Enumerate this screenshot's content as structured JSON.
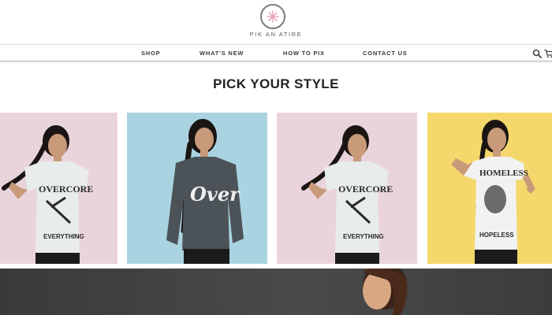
{
  "brand": {
    "name": "PIK AN ATIRE",
    "logo_color": "#e59ab5"
  },
  "nav": {
    "items": [
      {
        "label": "SHOP"
      },
      {
        "label": "WHAT'S NEW"
      },
      {
        "label": "HOW TO PIX"
      },
      {
        "label": "CONTACT US"
      }
    ],
    "icons": [
      "search-icon",
      "cart-icon"
    ]
  },
  "main": {
    "heading": "PICK YOUR STYLE"
  },
  "products": [
    {
      "shirt_text_top": "OVERCORE",
      "shirt_text_bottom": "EVERYTHING",
      "background": "#ead4dc",
      "shirt_color": "#e9ecec"
    },
    {
      "shirt_text_top": "Over",
      "background": "#aad3e1",
      "shirt_color": "#4c5358"
    },
    {
      "shirt_text_top": "OVERCORE",
      "shirt_text_bottom": "EVERYTHING",
      "background": "#ead4dc",
      "shirt_color": "#e9ecec"
    },
    {
      "shirt_text_top": "HOMELESS",
      "shirt_text_bottom": "HOPELESS",
      "background": "#f4d86c",
      "shirt_color": "#f2f2f2"
    }
  ]
}
